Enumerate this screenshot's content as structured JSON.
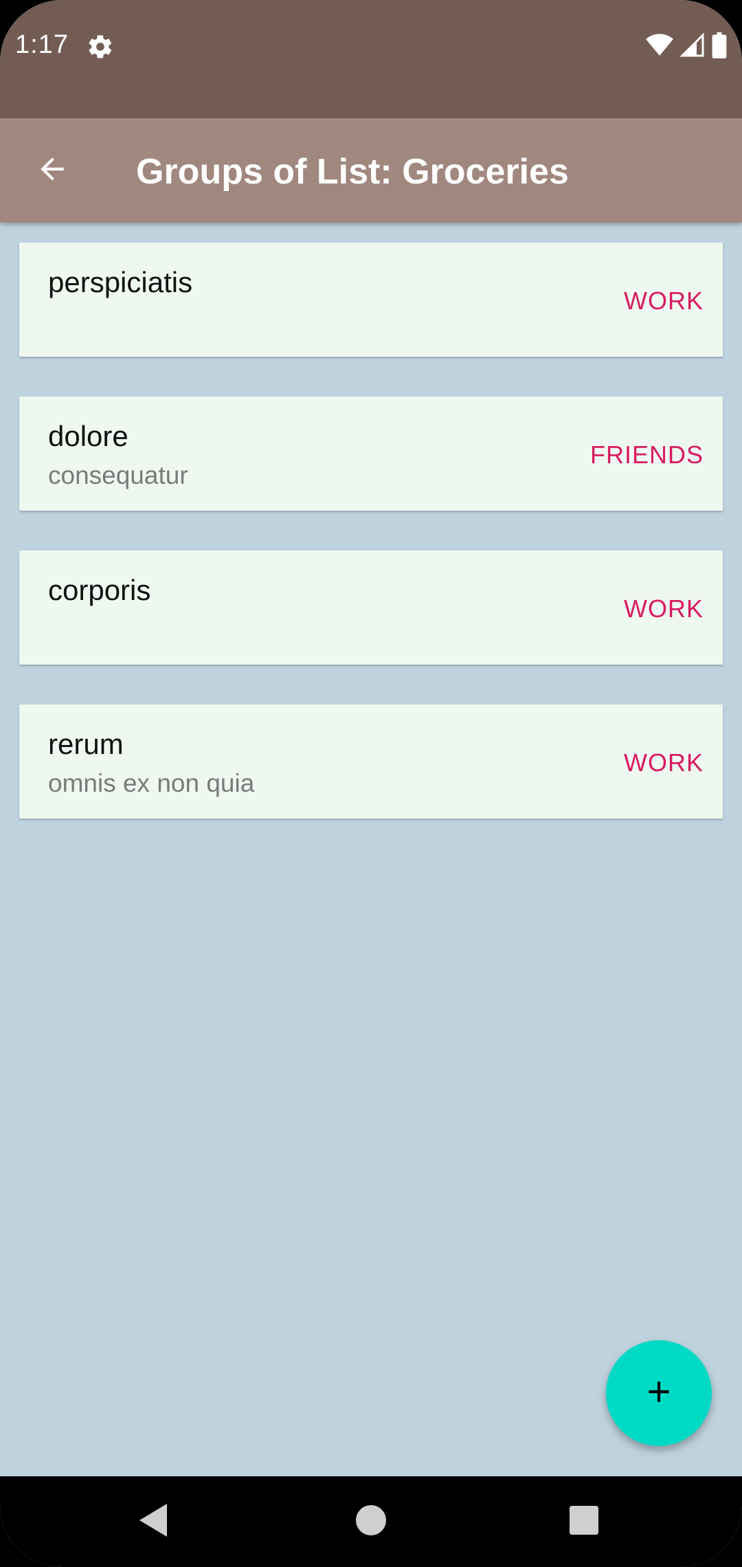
{
  "status_bar": {
    "time": "1:17",
    "icons": [
      "gear-icon",
      "wifi-icon",
      "signal-icon",
      "battery-icon"
    ]
  },
  "app_bar": {
    "back_icon": "arrow-left-icon",
    "title": "Groups of List: Groceries"
  },
  "groups": [
    {
      "title": "perspiciatis",
      "subtitle": "",
      "tag": "WORK"
    },
    {
      "title": "dolore",
      "subtitle": "consequatur",
      "tag": "FRIENDS"
    },
    {
      "title": "corporis",
      "subtitle": "",
      "tag": "WORK"
    },
    {
      "title": "rerum",
      "subtitle": "omnis ex non quia",
      "tag": "WORK"
    }
  ],
  "fab": {
    "icon": "plus-icon"
  },
  "nav_bar": {
    "icons": [
      "back-triangle-icon",
      "home-circle-icon",
      "recents-square-icon"
    ]
  },
  "colors": {
    "status_bar": "#725c54",
    "app_bar": "#a1887f",
    "background": "#bfd3df",
    "card": "#eff8f0",
    "tag": "#d81b60",
    "fab": "#00dac5"
  }
}
